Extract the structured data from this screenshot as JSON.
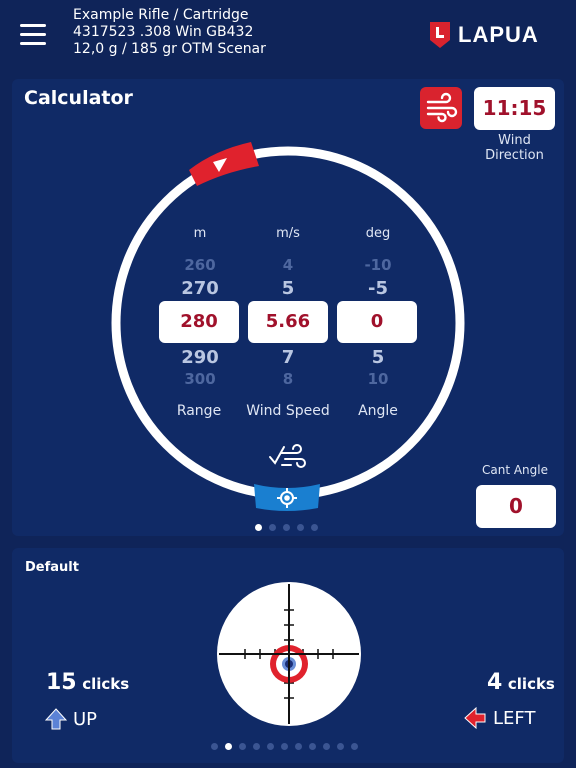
{
  "header": {
    "rifle_line": "Example Rifle / Cartridge",
    "cartridge_line": "4317523 .308 Win GB432",
    "bullet_line": "12,0 g / 185 gr  OTM Scenar",
    "logo_text": "LAPUA"
  },
  "calculator": {
    "title": "Calculator",
    "wind_time": "11:15",
    "wind_direction_label": [
      "Wind",
      "Direction"
    ],
    "columns": [
      {
        "unit": "m",
        "prev2": "260",
        "prev1": "270",
        "value": "280",
        "next1": "290",
        "next2": "300",
        "label": "Range"
      },
      {
        "unit": "m/s",
        "prev2": "4",
        "prev1": "5",
        "value": "5.66",
        "next1": "7",
        "next2": "8",
        "label": "Wind Speed"
      },
      {
        "unit": "deg",
        "prev2": "-10",
        "prev1": "-5",
        "value": "0",
        "next1": "5",
        "next2": "10",
        "label": "Angle"
      }
    ],
    "cant_angle_label": "Cant Angle",
    "cant_angle_value": "0",
    "page_dots": 5,
    "page_active": 0
  },
  "default_panel": {
    "title": "Default",
    "vertical_clicks": "15",
    "vertical_unit": "clicks",
    "vertical_direction": "UP",
    "horizontal_clicks": "4",
    "horizontal_unit": "clicks",
    "horizontal_direction": "LEFT",
    "page_dots": 11,
    "page_active": 1
  },
  "colors": {
    "background": "#0f2459",
    "card": "#102a66",
    "accent_red": "#d9232e",
    "value_red": "#a0112b",
    "accent_blue": "#1a7fd0"
  },
  "icons": [
    "menu-icon",
    "lapua-logo-icon",
    "wind-icon",
    "wind-arrow-icon",
    "wind-check-icon",
    "target-icon",
    "arrow-up-icon",
    "arrow-left-icon"
  ]
}
